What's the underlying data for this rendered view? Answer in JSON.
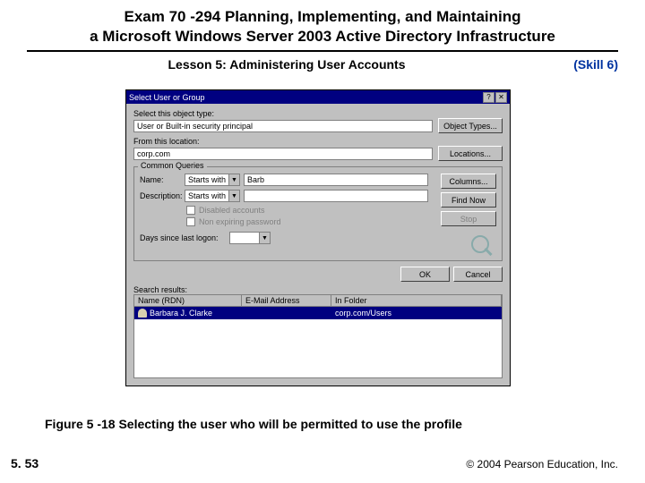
{
  "header": {
    "title_line1": "Exam 70 -294 Planning, Implementing, and Maintaining",
    "title_line2": "a Microsoft Windows Server 2003 Active Directory Infrastructure",
    "lesson": "Lesson 5: Administering User Accounts",
    "skill": "(Skill 6)"
  },
  "dialog": {
    "title": "Select User or Group",
    "select_label": "Select this object type:",
    "object_type_value": "User or Built-in security principal",
    "object_types_btn": "Object Types...",
    "from_label": "From this location:",
    "location_value": "corp.com",
    "locations_btn": "Locations...",
    "common_queries": "Common Queries",
    "name_label": "Name:",
    "name_mode": "Starts with",
    "name_value": "Barb",
    "desc_label": "Description:",
    "desc_mode": "Starts with",
    "desc_value": "",
    "chk_disabled": "Disabled accounts",
    "chk_nonexp": "Non expiring password",
    "days_label": "Days since last logon:",
    "days_value": "",
    "columns_btn": "Columns...",
    "findnow_btn": "Find Now",
    "stop_btn": "Stop",
    "ok_btn": "OK",
    "cancel_btn": "Cancel",
    "search_results": "Search results:",
    "col_name": "Name (RDN)",
    "col_email": "E-Mail Address",
    "col_folder": "In Folder",
    "row_name": "Barbara J. Clarke",
    "row_email": "",
    "row_folder": "corp.com/Users"
  },
  "figure_caption": "Figure 5 -18 Selecting the user who will be permitted to use the profile",
  "page_number": "5. 53",
  "copyright": "© 2004 Pearson Education, Inc."
}
